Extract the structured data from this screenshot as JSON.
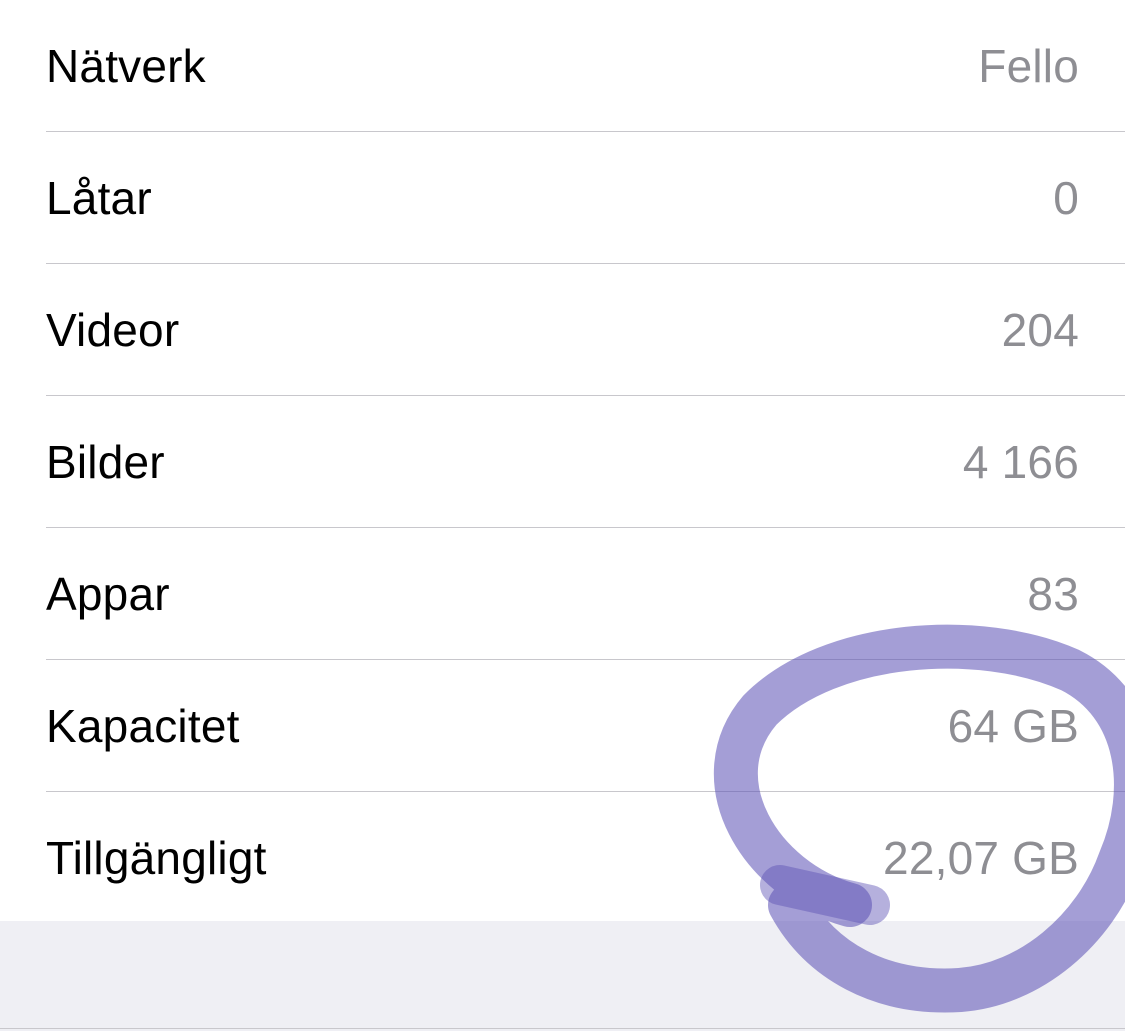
{
  "rows": [
    {
      "label": "Nätverk",
      "value": "Fello"
    },
    {
      "label": "Låtar",
      "value": "0"
    },
    {
      "label": "Videor",
      "value": "204"
    },
    {
      "label": "Bilder",
      "value": "4 166"
    },
    {
      "label": "Appar",
      "value": "83"
    },
    {
      "label": "Kapacitet",
      "value": "64 GB"
    },
    {
      "label": "Tillgängligt",
      "value": "22,07 GB"
    }
  ],
  "colors": {
    "label": "#000000",
    "value": "#8e8e93",
    "separator": "#c8c7cc",
    "background": "#efeff4",
    "annotation": "#5a4fb4"
  },
  "annotation": {
    "icon": "hand-drawn-circle-annotation"
  }
}
